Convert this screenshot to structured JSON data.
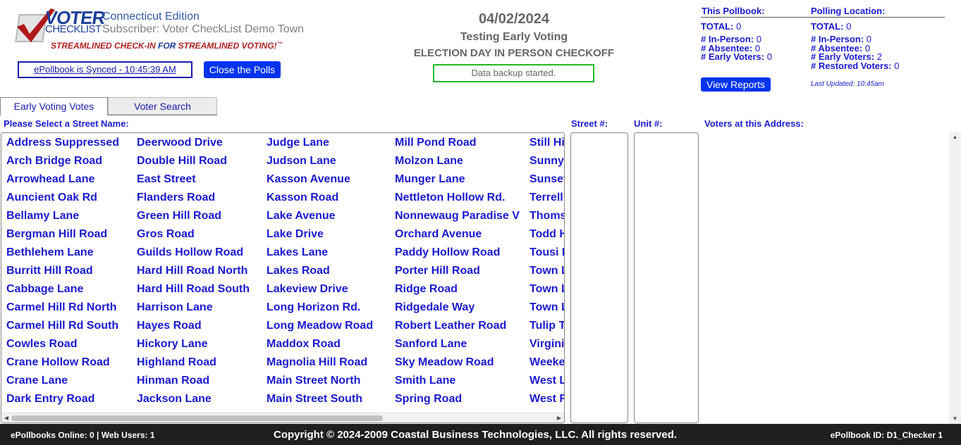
{
  "brand": {
    "logo_voter": "VOTER",
    "logo_checklist": "CHECKLIST",
    "tagline_red": "STREAMLINED CHECK-IN",
    "tagline_for": " FOR ",
    "tagline_blue": "STREAMLINED VOTING!",
    "tagline_tm": "™"
  },
  "header": {
    "edition": "Connecticut Edition",
    "subscriber": "Subscriber: Voter CheckList Demo Town",
    "sync_status": "ePollbook is Synced - 10:45:39 AM",
    "close_polls_label": "Close the Polls",
    "date": "04/02/2024",
    "election_name": "Testing Early Voting",
    "mode": "ELECTION DAY IN PERSON CHECKOFF",
    "backup_status": "Data backup started."
  },
  "stats": {
    "pollbook": {
      "title": "This Pollbook:",
      "total_label": "TOTAL:",
      "total": "0",
      "in_person_label": "# In-Person:",
      "in_person": "0",
      "absentee_label": "# Absentee:",
      "absentee": "0",
      "early_label": "# Early Voters:",
      "early": "0"
    },
    "location": {
      "title": "Polling Location:",
      "total_label": "TOTAL:",
      "total": "0",
      "in_person_label": "# In-Person:",
      "in_person": "0",
      "absentee_label": "# Absentee:",
      "absentee": "0",
      "early_label": "# Early Voters:",
      "early": "2",
      "restored_label": "# Restored Voters:",
      "restored": "0"
    },
    "view_reports_label": "View Reports",
    "last_updated": "Last Updated: 10:45am"
  },
  "tabs": [
    {
      "label": "Early Voting Votes",
      "active": true
    },
    {
      "label": "Voter Search",
      "active": false
    }
  ],
  "columns": {
    "street_prompt": "Please Select a Street Name:",
    "street_num": "Street #:",
    "unit_num": "Unit #:",
    "voters_at_address": "Voters at this Address:"
  },
  "streets": [
    [
      "Address Suppressed",
      "Arch Bridge Road",
      "Arrowhead Lane",
      "Auncient Oak Rd",
      "Bellamy Lane",
      "Bergman Hill Road",
      "Bethlehem Lane",
      "Burritt Hill Road",
      "Cabbage Lane",
      "Carmel Hill Rd North",
      "Carmel Hill Rd South",
      "Cowles Road",
      "Crane Hollow Road",
      "Crane Lane",
      "Dark Entry Road"
    ],
    [
      "Deerwood Drive",
      "Double Hill Road",
      "East Street",
      "Flanders Road",
      "Green Hill Road",
      "Gros Road",
      "Guilds Hollow Road",
      "Hard Hill Road North",
      "Hard Hill Road South",
      "Harrison Lane",
      "Hayes Road",
      "Hickory Lane",
      "Highland Road",
      "Hinman Road",
      "Jackson Lane"
    ],
    [
      "Judge Lane",
      "Judson Lane",
      "Kasson Avenue",
      "Kasson Road",
      "Lake Avenue",
      "Lake Drive",
      "Lakes Lane",
      "Lakes Road",
      "Lakeview Drive",
      "Long Horizon Rd.",
      "Long Meadow Road",
      "Maddox Road",
      "Magnolia Hill Road",
      "Main Street North",
      "Main Street South"
    ],
    [
      "Mill Pond Road",
      "Molzon Lane",
      "Munger Lane",
      "Nettleton Hollow Rd.",
      "Nonnewaug Paradise V",
      "Orchard Avenue",
      "Paddy Hollow Road",
      "Porter Hill Road",
      "Ridge Road",
      "Ridgedale Way",
      "Robert Leather Road",
      "Sanford Lane",
      "Sky Meadow Road",
      "Smith Lane",
      "Spring Road"
    ],
    [
      "Still Hi",
      "Sunny",
      "Sunset",
      "Terrell",
      "Thoms",
      "Todd H",
      "Tousi R",
      "Town L",
      "Town L",
      "Town L",
      "Tulip T",
      "Virginia",
      "Weeke",
      "West L",
      "West R"
    ]
  ],
  "footer": {
    "left": "ePollbooks Online: 0 | Web Users: 1",
    "center": "Copyright © 2024-2009 Coastal Business Technologies, LLC. All rights reserved.",
    "right": "ePollbook ID: D1_Checker 1"
  }
}
